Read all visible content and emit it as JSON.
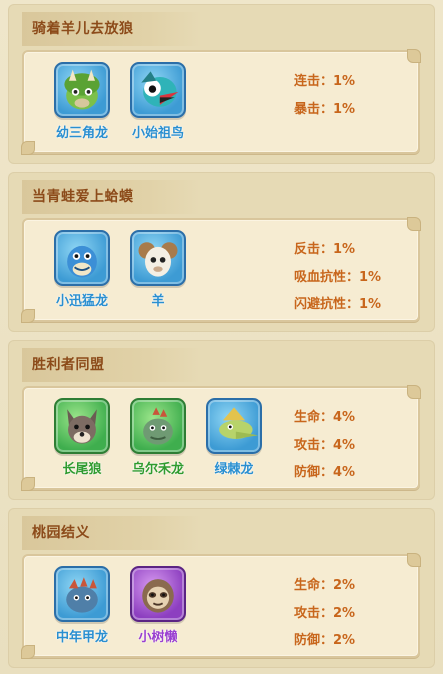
{
  "sections": [
    {
      "title": "骑着羊儿去放狼",
      "pets": [
        {
          "name": "幼三角龙",
          "frame": "blue",
          "icon": "triceratops-icon"
        },
        {
          "name": "小始祖鸟",
          "frame": "blue",
          "icon": "archaeopteryx-icon"
        }
      ],
      "stats": [
        "连击：1%",
        "暴击：1%"
      ]
    },
    {
      "title": "当青蛙爱上蛤蟆",
      "pets": [
        {
          "name": "小迅猛龙",
          "frame": "blue",
          "icon": "raptor-icon"
        },
        {
          "name": "羊",
          "frame": "blue",
          "icon": "sheep-icon"
        }
      ],
      "stats": [
        "反击：1%",
        "吸血抗性：1%",
        "闪避抗性：1%"
      ]
    },
    {
      "title": "胜利者同盟",
      "pets": [
        {
          "name": "长尾狼",
          "frame": "green",
          "icon": "wolf-icon"
        },
        {
          "name": "乌尔禾龙",
          "frame": "green",
          "icon": "wuerhosaurus-icon"
        },
        {
          "name": "绿棘龙",
          "frame": "blue",
          "icon": "spinosaurus-icon"
        }
      ],
      "stats": [
        "生命：4%",
        "攻击：4%",
        "防御：4%"
      ]
    },
    {
      "title": "桃园结义",
      "pets": [
        {
          "name": "中年甲龙",
          "frame": "blue",
          "icon": "ankylosaurus-icon"
        },
        {
          "name": "小树懒",
          "frame": "purple",
          "icon": "sloth-icon"
        }
      ],
      "stats": [
        "生命：2%",
        "攻击：2%",
        "防御：2%"
      ]
    }
  ],
  "colors": {
    "title_text": "#8c4b1a",
    "stat_text": "#c8661c",
    "name_blue": "#2a8fd0",
    "name_green": "#2f9b2f",
    "name_purple": "#9a3fd0"
  }
}
